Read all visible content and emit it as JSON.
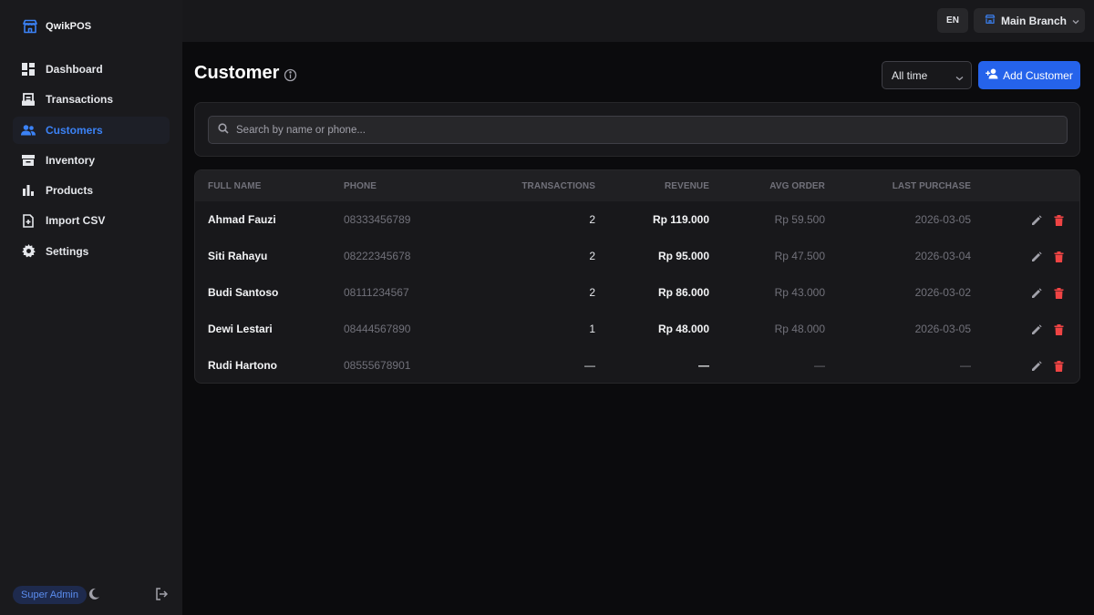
{
  "app": {
    "name": "QwikPOS",
    "brand_color": "#3b82f6"
  },
  "sidebar": {
    "items": [
      {
        "label": "Dashboard",
        "icon": "dashboard-icon",
        "active": false
      },
      {
        "label": "Transactions",
        "icon": "receipt-icon",
        "active": false
      },
      {
        "label": "Customers",
        "icon": "users-icon",
        "active": true
      },
      {
        "label": "Inventory",
        "icon": "archive-box-icon",
        "active": false
      },
      {
        "label": "Products",
        "icon": "bar-chart-icon",
        "active": false
      },
      {
        "label": "Import CSV",
        "icon": "file-import-icon",
        "active": false
      },
      {
        "label": "Settings",
        "icon": "gear-icon",
        "active": false
      }
    ],
    "footer": {
      "role": "Super Admin",
      "theme_icon": "moon-icon",
      "logout_icon": "logout-icon"
    }
  },
  "topbar": {
    "language": "EN",
    "branch": "Main Branch"
  },
  "header": {
    "title": "Customer",
    "period": "All time",
    "add_label": "Add Customer"
  },
  "search": {
    "placeholder": "Search by name or phone..."
  },
  "table": {
    "columns": [
      "FULL NAME",
      "PHONE",
      "TRANSACTIONS",
      "REVENUE",
      "AVG ORDER",
      "LAST PURCHASE"
    ],
    "rows": [
      {
        "name": "Ahmad Fauzi",
        "phone": "08333456789",
        "transactions": "2",
        "revenue": "Rp 119.000",
        "avg_order": "Rp 59.500",
        "last_purchase": "2026-03-05"
      },
      {
        "name": "Siti Rahayu",
        "phone": "08222345678",
        "transactions": "2",
        "revenue": "Rp 95.000",
        "avg_order": "Rp 47.500",
        "last_purchase": "2026-03-04"
      },
      {
        "name": "Budi Santoso",
        "phone": "08111234567",
        "transactions": "2",
        "revenue": "Rp 86.000",
        "avg_order": "Rp 43.000",
        "last_purchase": "2026-03-02"
      },
      {
        "name": "Dewi Lestari",
        "phone": "08444567890",
        "transactions": "1",
        "revenue": "Rp 48.000",
        "avg_order": "Rp 48.000",
        "last_purchase": "2026-03-05"
      },
      {
        "name": "Rudi Hartono",
        "phone": "08555678901",
        "transactions": "—",
        "revenue": "—",
        "avg_order": "—",
        "last_purchase": "—"
      }
    ]
  },
  "colors": {
    "accent": "#2563eb",
    "danger": "#ef4444",
    "muted": "#71717a"
  }
}
